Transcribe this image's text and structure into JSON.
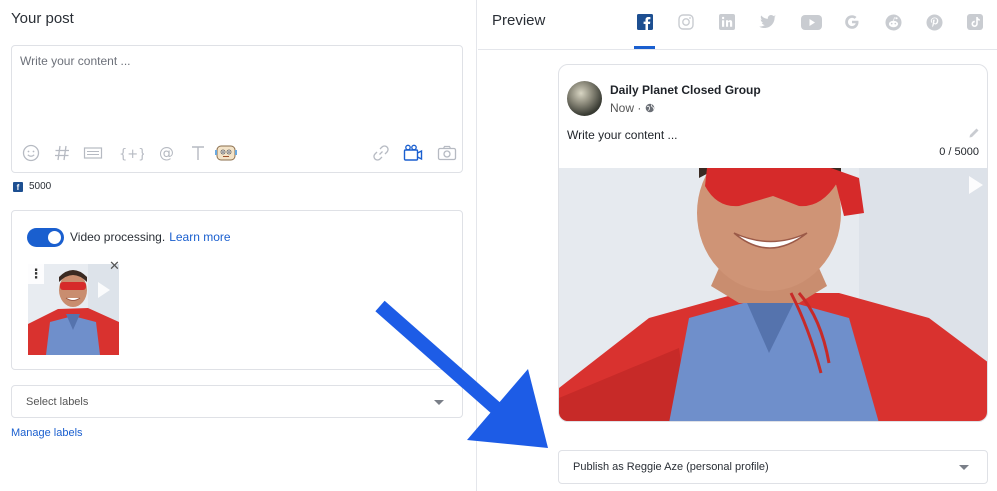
{
  "left": {
    "title": "Your post",
    "editor": {
      "placeholder": "Write your content ...",
      "tools": [
        "emoji-icon",
        "hashtag-icon",
        "snippet-icon",
        "variable-icon",
        "mention-icon",
        "text-format-icon",
        "ai-assistant-icon",
        "link-icon",
        "video-icon",
        "camera-icon"
      ]
    },
    "facebook_limit": "5000",
    "media": {
      "toggle_on": true,
      "video_processing_label": "Video processing.",
      "learn_more": "Learn more",
      "menu_glyph": "⋮",
      "close_glyph": "✕"
    },
    "labels": {
      "placeholder": "Select labels",
      "manage": "Manage labels"
    }
  },
  "right": {
    "title": "Preview",
    "networks": [
      "facebook-icon",
      "instagram-icon",
      "linkedin-icon",
      "twitter-icon",
      "youtube-icon",
      "google-icon",
      "reddit-icon",
      "pinterest-icon",
      "tiktok-icon"
    ],
    "active_network": "facebook-icon",
    "card": {
      "group_name": "Daily Planet Closed Group",
      "time": "Now ·",
      "content": "Write your content ...",
      "char_count": "0 / 5000"
    },
    "publish_as": "Publish as Reggie Aze (personal profile)"
  },
  "colors": {
    "accent": "#1a5fcf",
    "facebook": "#1d4f91",
    "arrow": "#1d5ce6",
    "icon_grey": "#b6bac2",
    "cape_red": "#e0302f",
    "scrubs_blue": "#6f8fcb"
  }
}
